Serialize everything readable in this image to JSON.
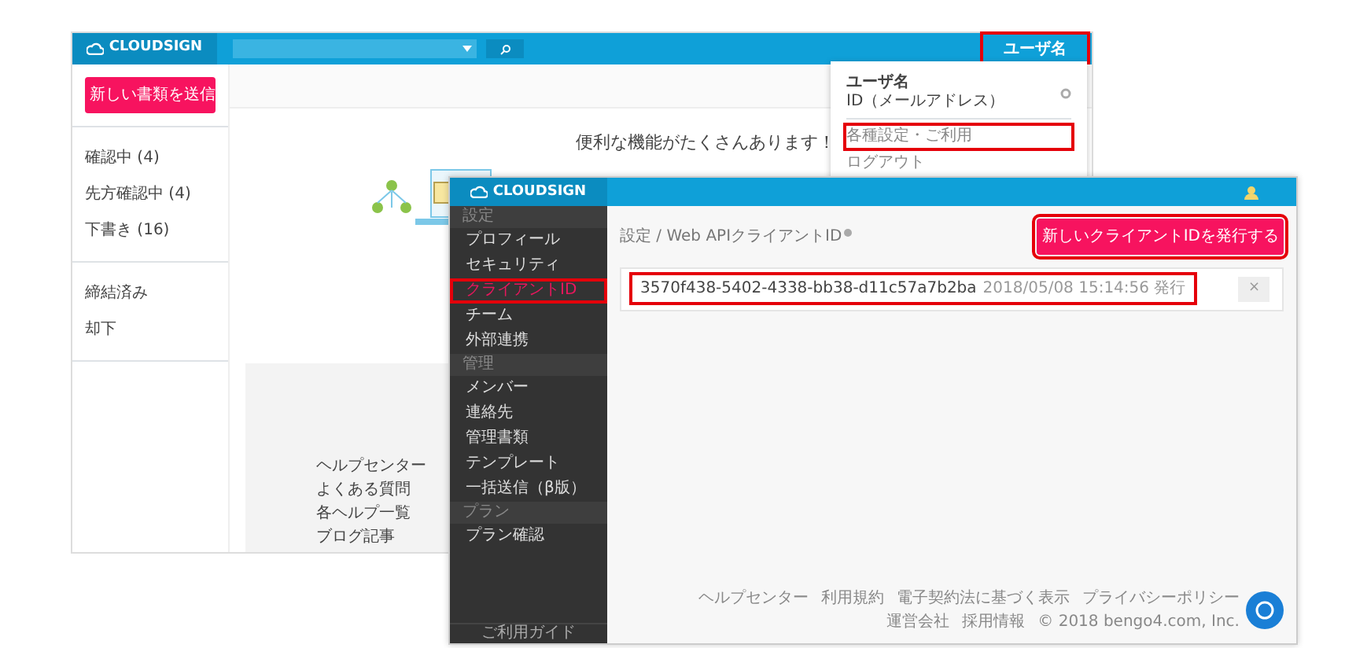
{
  "back_window": {
    "logo": "CLOUDSIGN",
    "user_menu": {
      "label": "ユーザ名",
      "highlighted": true
    },
    "new_document_button": "新しい書類を送信",
    "sidebar": {
      "groups": [
        [
          {
            "label": "確認中 (4)"
          },
          {
            "label": "先方確認中 (4)"
          },
          {
            "label": "下書き (16)"
          }
        ],
        [
          {
            "label": "締結済み"
          },
          {
            "label": "却下"
          }
        ]
      ]
    },
    "dropdown": {
      "user_name": "ユーザ名",
      "user_id": "ID（メールアドレス）",
      "links": [
        {
          "label": "各種設定・ご利用",
          "highlighted": true
        },
        {
          "label": "ログアウト",
          "highlighted": false
        }
      ]
    },
    "headline": "便利な機能がたくさんあります！",
    "help": {
      "title": "ヘルプセンター",
      "links": [
        "よくある質問",
        "各ヘルプ一覧",
        "ブログ記事"
      ]
    }
  },
  "front_window": {
    "logo": "CLOUDSIGN",
    "sidebar": {
      "sections": [
        {
          "header": "設定",
          "items": [
            {
              "label": "プロフィール",
              "selected": false,
              "highlighted": false
            },
            {
              "label": "セキュリティ",
              "selected": false,
              "highlighted": false
            },
            {
              "label": "クライアントID",
              "selected": true,
              "highlighted": true
            },
            {
              "label": "チーム",
              "selected": false,
              "highlighted": false
            },
            {
              "label": "外部連携",
              "selected": false,
              "highlighted": false
            }
          ]
        },
        {
          "header": "管理",
          "items": [
            {
              "label": "メンバー",
              "selected": false,
              "highlighted": false
            },
            {
              "label": "連絡先",
              "selected": false,
              "highlighted": false
            },
            {
              "label": "管理書類",
              "selected": false,
              "highlighted": false
            },
            {
              "label": "テンプレート",
              "selected": false,
              "highlighted": false
            },
            {
              "label": "一括送信（β版）",
              "selected": false,
              "highlighted": false
            }
          ]
        },
        {
          "header": "プラン",
          "items": [
            {
              "label": "プラン確認",
              "selected": false,
              "highlighted": false
            }
          ]
        }
      ],
      "footer": "ご利用ガイド"
    },
    "breadcrumb": "設定 / Web APIクライアントID",
    "issue_button": {
      "label": "新しいクライアントIDを発行する",
      "highlighted": true
    },
    "clients": [
      {
        "id": "3570f438-5402-4338-bb38-d11c57a7b2ba",
        "issued": "2018/05/08 15:14:56 発行",
        "delete": "×",
        "highlighted": true
      }
    ],
    "footer_links": [
      "ヘルプセンター",
      "利用規約",
      "電子契約法に基づく表示",
      "プライバシーポリシー",
      "運営会社",
      "採用情報",
      "© 2018 bengo4.com, Inc."
    ]
  }
}
